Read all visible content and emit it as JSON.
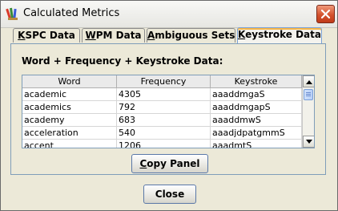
{
  "window": {
    "title": "Calculated Metrics"
  },
  "tabs": [
    {
      "mnemonic": "K",
      "rest": "SPC Data",
      "active": false
    },
    {
      "mnemonic": "W",
      "rest": "PM Data",
      "active": false
    },
    {
      "mnemonic": "A",
      "rest": "mbiguous Sets",
      "active": false
    },
    {
      "mnemonic": "K",
      "rest": "eystroke Data",
      "active": true
    }
  ],
  "panel": {
    "heading": "Word + Frequency + Keystroke Data:",
    "table": {
      "headers": [
        "Word",
        "Frequency",
        "Keystroke"
      ],
      "rows": [
        [
          "academic",
          "4305",
          "aaaddmgaS"
        ],
        [
          "academics",
          "792",
          "aaaddmgapS"
        ],
        [
          "academy",
          "683",
          "aaaddmwS"
        ],
        [
          "acceleration",
          "540",
          "aaadjdpatgmmS"
        ],
        [
          "accent",
          "1206",
          "aaadmtS"
        ]
      ]
    },
    "copy_button": {
      "mnemonic": "C",
      "rest": "opy Panel"
    }
  },
  "close_button": {
    "label": "Close"
  },
  "icons": {
    "app": "app-pencils-icon",
    "close": "close-x-icon"
  },
  "colors": {
    "active_tab_accent": "#f7b648",
    "close_button": "#d4522e",
    "border_blue": "#7f9db9"
  }
}
